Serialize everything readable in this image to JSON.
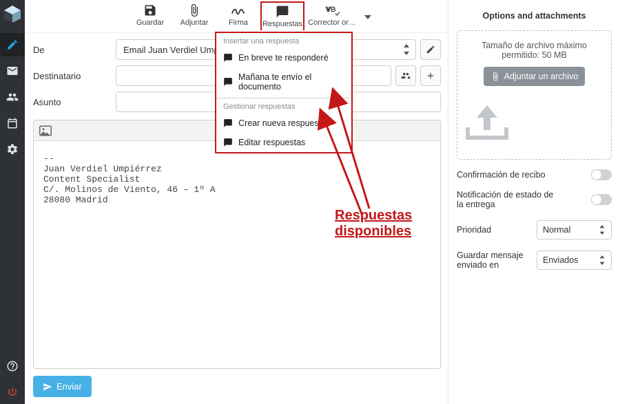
{
  "rail": {
    "items": [
      "compose",
      "mail",
      "contacts",
      "calendar",
      "settings"
    ],
    "help": "help",
    "logout": "logout"
  },
  "toolbar": {
    "save": "Guardar",
    "attach": "Adjuntar",
    "sign": "Firma",
    "responses": "Respuestas",
    "spell": "Corrector or…"
  },
  "dropdown": {
    "insert_header": "Insertar una respuesta",
    "resp1": "En breve te responderé",
    "resp2": "Mañana te envío el documento",
    "manage_header": "Gestionar respuestas",
    "create": "Crear nueva respuesta",
    "edit": "Editar respuestas"
  },
  "compose": {
    "from_label": "De",
    "from_value": "Email Juan Verdiel Umpié",
    "to_label": "Destinatario",
    "subject_label": "Asunto",
    "signature": "--\nJuan Verdiel Umpiérrez\nContent Specialist\nC/. Molinos de Viento, 46 – 1º A\n28080 Madrid",
    "send": "Enviar"
  },
  "annotation": {
    "label_line1": "Respuestas",
    "label_line2": "disponibles"
  },
  "side": {
    "title": "Options and attachments",
    "max_text": "Tamaño de archivo máximo permitido: 50 MB",
    "attach_btn": "Adjuntar un archivo",
    "receipt": "Confirmación de recibo",
    "dsn": "Notificación de estado de la entrega",
    "priority_label": "Prioridad",
    "priority_value": "Normal",
    "savein_label": "Guardar mensaje enviado en",
    "savein_value": "Enviados"
  }
}
